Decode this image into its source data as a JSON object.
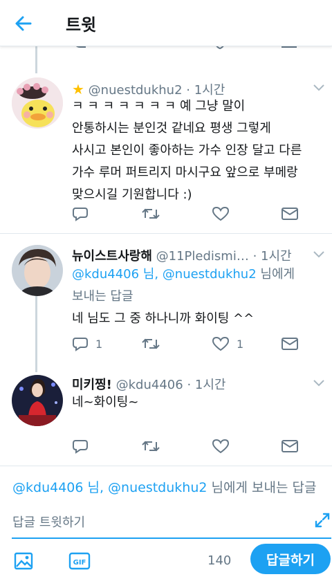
{
  "header": {
    "title": "트윗"
  },
  "tweets": [
    {
      "emoji": "★",
      "name": "",
      "handle": "@nuestdukhu2",
      "time": "1시간",
      "reply_to": "",
      "lines": [
        "ㅋ ㅋ ㅋ ㅋ ㅋ ㅋ ㅋ 예 그냥 말이",
        "안통하시는 분인것 같네요 평생 그렇게",
        "사시고 본인이 좋아하는 가수 인장 달고 다른",
        "가수 루머 퍼트리지 마시구요 앞으로 부메랑",
        "맞으시길 기원합니다 :)"
      ],
      "reply_count": "",
      "like_count": ""
    },
    {
      "name": "뉴이스트사랑해",
      "handle": "@11Pledismi…",
      "time": "1시간",
      "reply_to_prefix": "@kdu4406 님, @nuestdukhu2",
      "reply_to_suffix": " 님에게",
      "reply_to_line2": "보내는 답글",
      "lines": [
        "네 님도 그 중 하나니까 화이팅 ^^"
      ],
      "reply_count": "1",
      "like_count": "1"
    },
    {
      "name": "미키찡!",
      "handle": "@kdu4406",
      "time": "1시간",
      "lines": [
        "네~화이팅~"
      ],
      "reply_count": "",
      "like_count": ""
    }
  ],
  "composer": {
    "reply_target_link": "@kdu4406 님, @nuestdukhu2",
    "reply_target_suffix": " 님에게 보내는 답글",
    "placeholder": "답글 트윗하기",
    "char_count": "140",
    "submit_label": "답글하기",
    "gif_label": "GIF"
  },
  "colors": {
    "accent": "#1da1f2",
    "muted": "#657786",
    "star": "#ffc000"
  }
}
